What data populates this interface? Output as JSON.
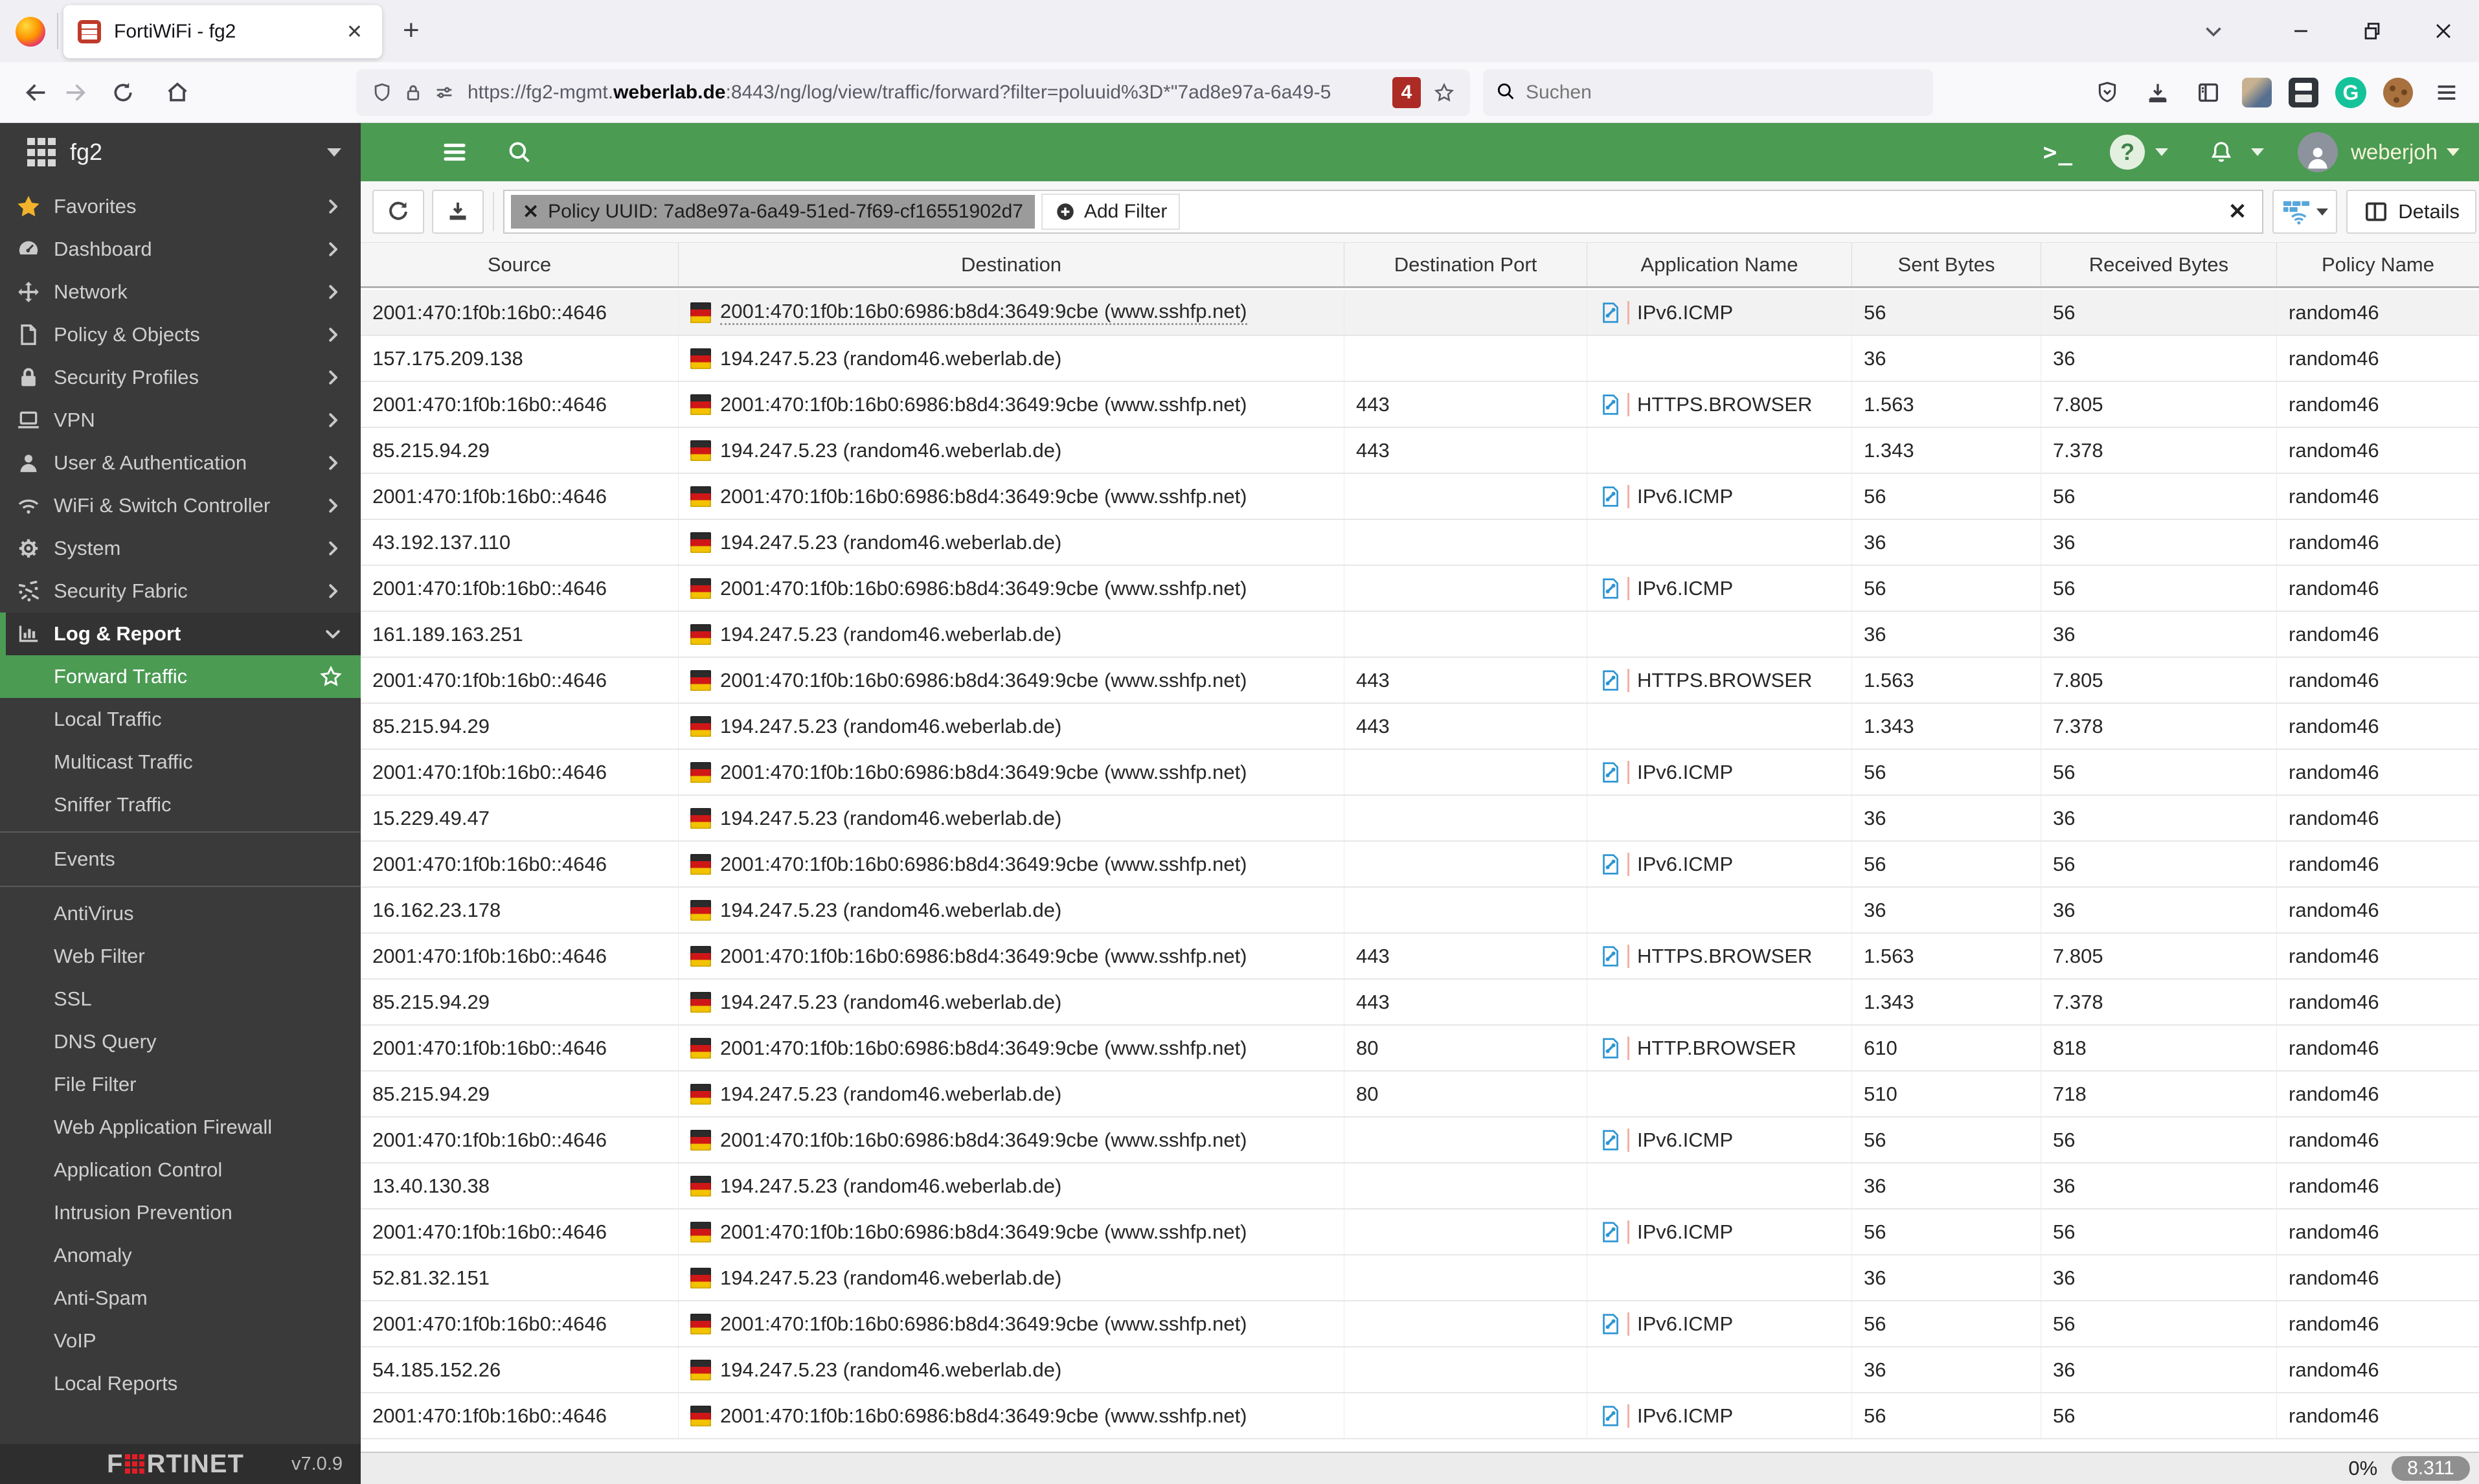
{
  "browser": {
    "tab_title": "FortiWiFi - fg2",
    "tab_close": "✕",
    "new_tab": "+",
    "url_prefix": "https://fg2-mgmt.",
    "url_domain": "weberlab.de",
    "url_suffix": ":8443/ng/log/view/traffic/forward?filter=poluuid%3D*\"7ad8e97a-6a49-5",
    "url_badge": "4",
    "search_placeholder": "Suchen"
  },
  "topbar": {
    "hostname": "fg2",
    "terminal_glyph": ">_",
    "help_glyph": "?",
    "username": "weberjoh"
  },
  "toolbar": {
    "filter_chip_close": "✕",
    "filter_chip": "Policy UUID:  7ad8e97a-6a49-51ed-7f69-cf16551902d7",
    "add_filter_label": "Add Filter",
    "clear_filters": "✕",
    "details_label": "Details"
  },
  "sidebar": {
    "items": [
      {
        "id": "favorites",
        "label": "Favorites",
        "icon": "star-icon",
        "type": "top"
      },
      {
        "id": "dashboard",
        "label": "Dashboard",
        "icon": "gauge-icon",
        "type": "top"
      },
      {
        "id": "network",
        "label": "Network",
        "icon": "network-icon",
        "type": "top"
      },
      {
        "id": "policy-objects",
        "label": "Policy & Objects",
        "icon": "document-icon",
        "type": "top"
      },
      {
        "id": "security-profiles",
        "label": "Security Profiles",
        "icon": "lock-icon",
        "type": "top"
      },
      {
        "id": "vpn",
        "label": "VPN",
        "icon": "laptop-icon",
        "type": "top"
      },
      {
        "id": "user-authentication",
        "label": "User & Authentication",
        "icon": "user-icon",
        "type": "top"
      },
      {
        "id": "wifi-switch-controller",
        "label": "WiFi & Switch Controller",
        "icon": "wifi-icon",
        "type": "top",
        "two_line": true
      },
      {
        "id": "system",
        "label": "System",
        "icon": "gear-icon",
        "type": "top"
      },
      {
        "id": "security-fabric",
        "label": "Security Fabric",
        "icon": "fabric-icon",
        "type": "top"
      },
      {
        "id": "log-report",
        "label": "Log & Report",
        "icon": "chart-icon",
        "type": "top",
        "expanded": true
      },
      {
        "id": "forward-traffic",
        "label": "Forward Traffic",
        "type": "sub",
        "selected": true
      },
      {
        "id": "local-traffic",
        "label": "Local Traffic",
        "type": "sub"
      },
      {
        "id": "multicast-traffic",
        "label": "Multicast Traffic",
        "type": "sub"
      },
      {
        "id": "sniffer-traffic",
        "label": "Sniffer Traffic",
        "type": "sub"
      },
      {
        "divider": true
      },
      {
        "id": "events",
        "label": "Events",
        "type": "sub"
      },
      {
        "divider": true
      },
      {
        "id": "antivirus",
        "label": "AntiVirus",
        "type": "sub"
      },
      {
        "id": "web-filter",
        "label": "Web Filter",
        "type": "sub"
      },
      {
        "id": "ssl",
        "label": "SSL",
        "type": "sub"
      },
      {
        "id": "dns-query",
        "label": "DNS Query",
        "type": "sub"
      },
      {
        "id": "file-filter",
        "label": "File Filter",
        "type": "sub"
      },
      {
        "id": "web-application-firewall",
        "label": "Web Application Firewall",
        "type": "sub",
        "two_line": true
      },
      {
        "id": "application-control",
        "label": "Application Control",
        "type": "sub"
      },
      {
        "id": "intrusion-prevention",
        "label": "Intrusion Prevention",
        "type": "sub"
      },
      {
        "id": "anomaly",
        "label": "Anomaly",
        "type": "sub"
      },
      {
        "id": "anti-spam",
        "label": "Anti-Spam",
        "type": "sub"
      },
      {
        "id": "voip",
        "label": "VoIP",
        "type": "sub"
      },
      {
        "id": "local-reports",
        "label": "Local Reports",
        "type": "sub"
      }
    ],
    "footer": {
      "brand_pre": "F",
      "brand_post": "RTINET",
      "version": "v7.0.9"
    }
  },
  "table": {
    "columns": [
      "Source",
      "Destination",
      "Destination Port",
      "Application Name",
      "Sent Bytes",
      "Received Bytes",
      "Policy Name"
    ],
    "rows": [
      {
        "src": "2001:470:1f0b:16b0::4646",
        "dst": "2001:470:1f0b:16b0:6986:b8d4:3649:9cbe",
        "host": "www.sshfp.net",
        "port": "",
        "app": "IPv6.ICMP",
        "sent": "56",
        "recv": "56",
        "policy": "random46",
        "highlight": true
      },
      {
        "src": "157.175.209.138",
        "dst": "194.247.5.23",
        "host": "random46.weberlab.de",
        "port": "",
        "app": "",
        "sent": "36",
        "recv": "36",
        "policy": "random46"
      },
      {
        "src": "2001:470:1f0b:16b0::4646",
        "dst": "2001:470:1f0b:16b0:6986:b8d4:3649:9cbe",
        "host": "www.sshfp.net",
        "port": "443",
        "app": "HTTPS.BROWSER",
        "sent": "1.563",
        "recv": "7.805",
        "policy": "random46"
      },
      {
        "src": "85.215.94.29",
        "dst": "194.247.5.23",
        "host": "random46.weberlab.de",
        "port": "443",
        "app": "",
        "sent": "1.343",
        "recv": "7.378",
        "policy": "random46"
      },
      {
        "src": "2001:470:1f0b:16b0::4646",
        "dst": "2001:470:1f0b:16b0:6986:b8d4:3649:9cbe",
        "host": "www.sshfp.net",
        "port": "",
        "app": "IPv6.ICMP",
        "sent": "56",
        "recv": "56",
        "policy": "random46"
      },
      {
        "src": "43.192.137.110",
        "dst": "194.247.5.23",
        "host": "random46.weberlab.de",
        "port": "",
        "app": "",
        "sent": "36",
        "recv": "36",
        "policy": "random46"
      },
      {
        "src": "2001:470:1f0b:16b0::4646",
        "dst": "2001:470:1f0b:16b0:6986:b8d4:3649:9cbe",
        "host": "www.sshfp.net",
        "port": "",
        "app": "IPv6.ICMP",
        "sent": "56",
        "recv": "56",
        "policy": "random46"
      },
      {
        "src": "161.189.163.251",
        "dst": "194.247.5.23",
        "host": "random46.weberlab.de",
        "port": "",
        "app": "",
        "sent": "36",
        "recv": "36",
        "policy": "random46"
      },
      {
        "src": "2001:470:1f0b:16b0::4646",
        "dst": "2001:470:1f0b:16b0:6986:b8d4:3649:9cbe",
        "host": "www.sshfp.net",
        "port": "443",
        "app": "HTTPS.BROWSER",
        "sent": "1.563",
        "recv": "7.805",
        "policy": "random46"
      },
      {
        "src": "85.215.94.29",
        "dst": "194.247.5.23",
        "host": "random46.weberlab.de",
        "port": "443",
        "app": "",
        "sent": "1.343",
        "recv": "7.378",
        "policy": "random46"
      },
      {
        "src": "2001:470:1f0b:16b0::4646",
        "dst": "2001:470:1f0b:16b0:6986:b8d4:3649:9cbe",
        "host": "www.sshfp.net",
        "port": "",
        "app": "IPv6.ICMP",
        "sent": "56",
        "recv": "56",
        "policy": "random46"
      },
      {
        "src": "15.229.49.47",
        "dst": "194.247.5.23",
        "host": "random46.weberlab.de",
        "port": "",
        "app": "",
        "sent": "36",
        "recv": "36",
        "policy": "random46"
      },
      {
        "src": "2001:470:1f0b:16b0::4646",
        "dst": "2001:470:1f0b:16b0:6986:b8d4:3649:9cbe",
        "host": "www.sshfp.net",
        "port": "",
        "app": "IPv6.ICMP",
        "sent": "56",
        "recv": "56",
        "policy": "random46"
      },
      {
        "src": "16.162.23.178",
        "dst": "194.247.5.23",
        "host": "random46.weberlab.de",
        "port": "",
        "app": "",
        "sent": "36",
        "recv": "36",
        "policy": "random46"
      },
      {
        "src": "2001:470:1f0b:16b0::4646",
        "dst": "2001:470:1f0b:16b0:6986:b8d4:3649:9cbe",
        "host": "www.sshfp.net",
        "port": "443",
        "app": "HTTPS.BROWSER",
        "sent": "1.563",
        "recv": "7.805",
        "policy": "random46"
      },
      {
        "src": "85.215.94.29",
        "dst": "194.247.5.23",
        "host": "random46.weberlab.de",
        "port": "443",
        "app": "",
        "sent": "1.343",
        "recv": "7.378",
        "policy": "random46"
      },
      {
        "src": "2001:470:1f0b:16b0::4646",
        "dst": "2001:470:1f0b:16b0:6986:b8d4:3649:9cbe",
        "host": "www.sshfp.net",
        "port": "80",
        "app": "HTTP.BROWSER",
        "sent": "610",
        "recv": "818",
        "policy": "random46"
      },
      {
        "src": "85.215.94.29",
        "dst": "194.247.5.23",
        "host": "random46.weberlab.de",
        "port": "80",
        "app": "",
        "sent": "510",
        "recv": "718",
        "policy": "random46"
      },
      {
        "src": "2001:470:1f0b:16b0::4646",
        "dst": "2001:470:1f0b:16b0:6986:b8d4:3649:9cbe",
        "host": "www.sshfp.net",
        "port": "",
        "app": "IPv6.ICMP",
        "sent": "56",
        "recv": "56",
        "policy": "random46"
      },
      {
        "src": "13.40.130.38",
        "dst": "194.247.5.23",
        "host": "random46.weberlab.de",
        "port": "",
        "app": "",
        "sent": "36",
        "recv": "36",
        "policy": "random46"
      },
      {
        "src": "2001:470:1f0b:16b0::4646",
        "dst": "2001:470:1f0b:16b0:6986:b8d4:3649:9cbe",
        "host": "www.sshfp.net",
        "port": "",
        "app": "IPv6.ICMP",
        "sent": "56",
        "recv": "56",
        "policy": "random46"
      },
      {
        "src": "52.81.32.151",
        "dst": "194.247.5.23",
        "host": "random46.weberlab.de",
        "port": "",
        "app": "",
        "sent": "36",
        "recv": "36",
        "policy": "random46"
      },
      {
        "src": "2001:470:1f0b:16b0::4646",
        "dst": "2001:470:1f0b:16b0:6986:b8d4:3649:9cbe",
        "host": "www.sshfp.net",
        "port": "",
        "app": "IPv6.ICMP",
        "sent": "56",
        "recv": "56",
        "policy": "random46"
      },
      {
        "src": "54.185.152.26",
        "dst": "194.247.5.23",
        "host": "random46.weberlab.de",
        "port": "",
        "app": "",
        "sent": "36",
        "recv": "36",
        "policy": "random46"
      },
      {
        "src": "2001:470:1f0b:16b0::4646",
        "dst": "2001:470:1f0b:16b0:6986:b8d4:3649:9cbe",
        "host": "www.sshfp.net",
        "port": "",
        "app": "IPv6.ICMP",
        "sent": "56",
        "recv": "56",
        "policy": "random46"
      }
    ]
  },
  "statusbar": {
    "percent": "0%",
    "count": "8.311"
  },
  "colors": {
    "accent_green": "#4b9b53",
    "sidebar_bg": "#3a3a3a",
    "badge_red": "#ac2b25",
    "app_icon_blue": "#2e95d3"
  }
}
